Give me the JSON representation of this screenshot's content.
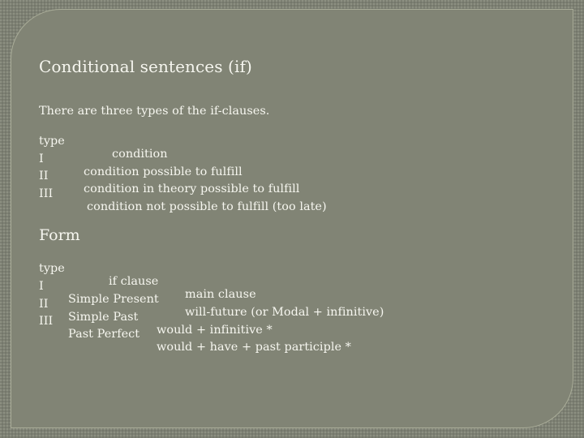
{
  "slide": {
    "title": "Conditional sentences (if)",
    "intro": "There are three types of the if-clauses.",
    "types_table": {
      "headers": [
        "type",
        "condition"
      ],
      "rows": [
        {
          "type": "I",
          "condition": "condition possible to fulfill"
        },
        {
          "type": "II",
          "condition": "condition in theory possible to fulfill"
        },
        {
          "type": "III",
          "condition": "condition not possible to fulfill (too late)"
        }
      ]
    },
    "form_title": "Form",
    "form_table": {
      "headers": [
        "type",
        "if clause",
        "main clause"
      ],
      "rows": [
        {
          "type": "I",
          "if_clause": "Simple Present",
          "main_clause": "will-future (or Modal + infinitive)"
        },
        {
          "type": "II",
          "if_clause": "Simple Past",
          "main_clause": "would + infinitive *"
        },
        {
          "type": "III",
          "if_clause": "Past Perfect",
          "main_clause": "would + have + past participle *"
        }
      ]
    }
  }
}
